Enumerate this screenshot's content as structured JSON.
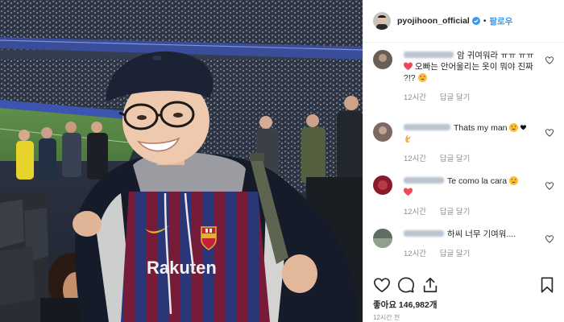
{
  "post": {
    "username": "pyojihoon_official",
    "follow_label": "팔로우",
    "dot": "•",
    "likes_label": "좋아요",
    "likes_count": "146,982개",
    "posted_time": "12시간 전"
  },
  "photo": {
    "jersey_sponsor": "Rakuten"
  },
  "comments": [
    {
      "text": "암 귀여워라 ㅠㅠ ㅠㅠ",
      "text_after_heart": "오빠는 안어울리는 옷이 뭐야 진짜 ?!?",
      "time": "12시간",
      "reply": "답글 달기",
      "avatar_color": "#6b5d55",
      "username_color": "#b9c4d0"
    },
    {
      "text": "Thats my man",
      "time": "12시간",
      "reply": "답글 달기",
      "avatar_color": "#7a6a62",
      "username_color": "#b9c4d0"
    },
    {
      "text": "Te como la cara",
      "time": "12시간",
      "reply": "답글 달기",
      "avatar_color": "#8a1a2a",
      "username_color": "#b9c4d0"
    },
    {
      "text": "하씨 너무 기여워....",
      "time": "12시간",
      "reply": "답글 달기",
      "avatar_color": "#5f6d62",
      "username_color": "#b9c4d0"
    }
  ],
  "colors": {
    "accent": "#3897f0",
    "verified": "#3897f0",
    "heart": "#ed4956",
    "meta_gray": "#8e8e8e",
    "text": "#262626"
  },
  "icons": {
    "like": "heart-outline-icon",
    "comment": "comment-bubble-icon",
    "share": "share-arrow-icon",
    "save": "bookmark-icon"
  }
}
